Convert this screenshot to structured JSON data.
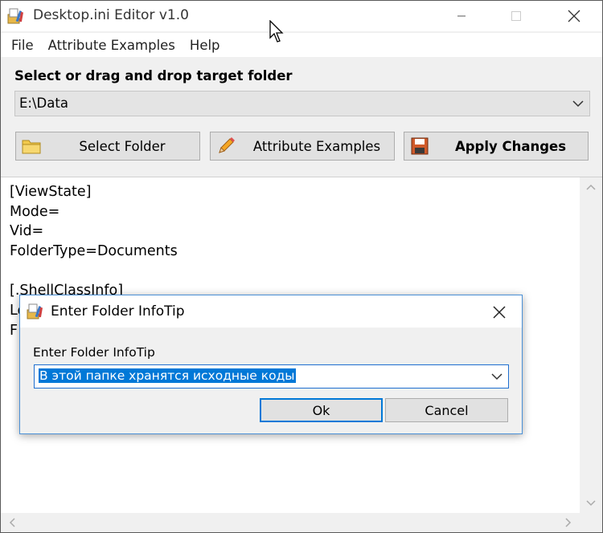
{
  "window": {
    "title": "Desktop.ini Editor v1.0",
    "app_icon": "app-icon"
  },
  "menu": [
    {
      "label": "File"
    },
    {
      "label": "Attribute Examples"
    },
    {
      "label": "Help"
    }
  ],
  "folder": {
    "label": "Select or drag and drop target folder",
    "path": "E:\\Data"
  },
  "toolbar": {
    "select_folder_label": "Select Folder",
    "attribute_examples_label": "Attribute Examples",
    "apply_changes_label": "Apply Changes"
  },
  "editor": {
    "lines": [
      "[ViewState]",
      "Mode=",
      "Vid=",
      "FolderType=Documents",
      "",
      "[.ShellClassInfo]",
      "Lo",
      "F"
    ]
  },
  "dialog": {
    "title": "Enter Folder InfoTip",
    "label": "Enter Folder InfoTip",
    "value": "В этой папке хранятся исходные коды",
    "ok_label": "Ok",
    "cancel_label": "Cancel"
  },
  "colors": {
    "accent": "#0078d7",
    "button_face": "#e1e1e1",
    "window_bg": "#f0f0f0"
  }
}
